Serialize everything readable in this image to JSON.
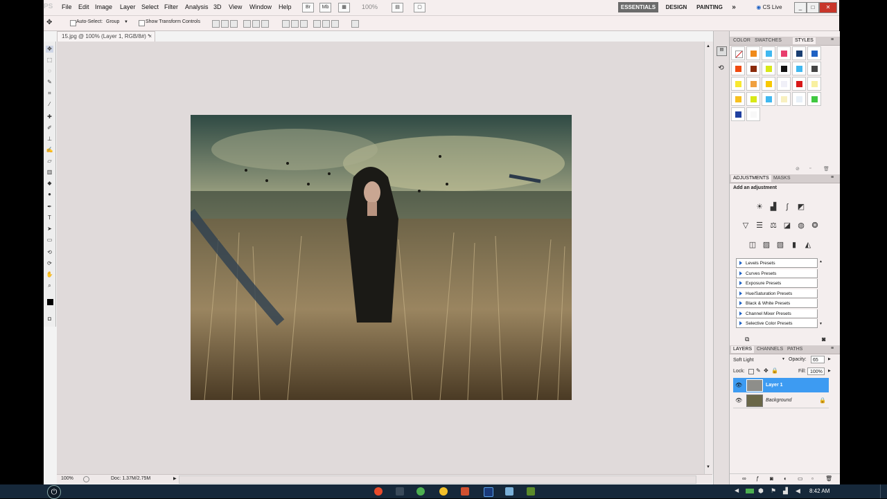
{
  "menubar": {
    "logo": "PS",
    "items": [
      "File",
      "Edit",
      "Image",
      "Layer",
      "Select",
      "Filter",
      "Analysis",
      "3D",
      "View",
      "Window",
      "Help"
    ],
    "bridge_label": "Br",
    "minibridge_label": "Mb",
    "zoom": "100%",
    "workspaces": [
      "ESSENTIALS",
      "DESIGN",
      "PAINTING"
    ],
    "more": "»",
    "cs_live": "CS Live"
  },
  "options": {
    "auto_select_label": "Auto-Select:",
    "auto_select_value": "Group",
    "show_transform_label": "Show Transform Controls"
  },
  "document": {
    "tab_title": "15.jpg @ 100% (Layer 1, RGB/8#) *",
    "zoom": "100%",
    "doc_size": "Doc: 1.37M/2.75M"
  },
  "colors": {
    "accent": "#3d9bf2",
    "panel_bg": "#f4eeee"
  },
  "styles_panel": {
    "tabs": [
      "COLOR",
      "SWATCHES",
      "STYLES"
    ],
    "active_tab": "STYLES",
    "swatches": [
      "none",
      "#f08a1a",
      "#40b8f0",
      "#e83e6e",
      "#1a3f72",
      "#1f62c4",
      "#f04a10",
      "#8a2a0a",
      "#d8e818",
      "#111111",
      "#40b8f0",
      "#444444",
      "#f8e830",
      "#f0a040",
      "#f8c800",
      "#f0f0f8",
      "#d81818",
      "#f8f0a0",
      "#f8c020",
      "#d8e818",
      "#40b8f0",
      "#f8f0c0",
      "#e8f0f8",
      "#40c840",
      "#2040a0",
      "#f8f8f8"
    ]
  },
  "adjustments_panel": {
    "tabs": [
      "ADJUSTMENTS",
      "MASKS"
    ],
    "header": "Add an adjustment",
    "presets": [
      "Levels Presets",
      "Curves Presets",
      "Exposure Presets",
      "Hue/Saturation Presets",
      "Black & White Presets",
      "Channel Mixer Presets",
      "Selective Color Presets"
    ]
  },
  "layers_panel": {
    "tabs": [
      "LAYERS",
      "CHANNELS",
      "PATHS"
    ],
    "blend_mode": "Soft Light",
    "opacity_label": "Opacity:",
    "opacity_value": "65",
    "lock_label": "Lock:",
    "fill_label": "Fill:",
    "fill_value": "100%",
    "layers": [
      {
        "name": "Layer 1",
        "selected": true
      },
      {
        "name": "Background",
        "selected": false,
        "locked": true
      }
    ]
  },
  "taskbar": {
    "clock": "8:42 AM"
  }
}
